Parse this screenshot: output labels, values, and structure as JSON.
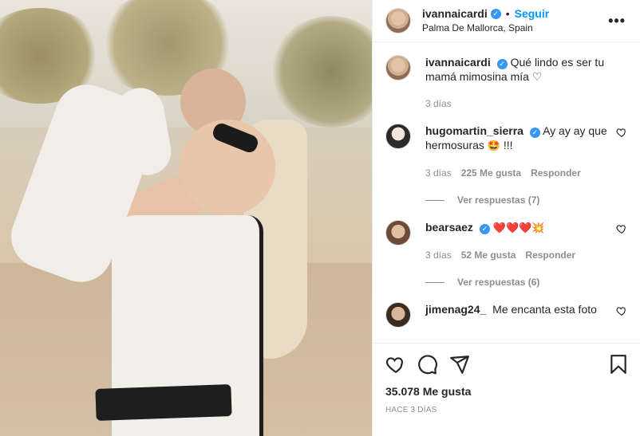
{
  "post": {
    "author": {
      "username": "ivannaicardi",
      "verified": true,
      "follow_label": "Seguir",
      "location": "Palma De Mallorca, Spain"
    },
    "caption": {
      "username": "ivannaicardi",
      "text": "Qué lindo es ser tu mamá mimosina mía",
      "emoji": "♡",
      "time": "3 días"
    },
    "comments": [
      {
        "username": "hugomartin_sierra",
        "verified": true,
        "text": "Ay ay ay que hermosuras",
        "emoji": "🤩",
        "suffix": " !!!",
        "time": "3 días",
        "likes": "225 Me gusta",
        "reply_label": "Responder",
        "view_replies": "Ver respuestas (7)"
      },
      {
        "username": "bearsaez",
        "verified": true,
        "text": "",
        "emoji": "❤️❤️❤️💥",
        "time": "3 días",
        "likes": "52 Me gusta",
        "reply_label": "Responder",
        "view_replies": "Ver respuestas (6)"
      },
      {
        "username": "jimenag24_",
        "verified": false,
        "text": "Me encanta esta foto"
      }
    ],
    "likes_count": "35.078 Me gusta",
    "time_ago": "HACE 3 DÍAS"
  },
  "icons": {
    "more": "more-options-icon",
    "heart": "heart-icon",
    "comment": "comment-icon",
    "share": "share-icon",
    "bookmark": "bookmark-icon",
    "verified": "verified-badge-icon"
  },
  "colors": {
    "accent": "#0095f6",
    "verified": "#3897f0",
    "muted": "#8e8e8e",
    "text": "#262626"
  }
}
